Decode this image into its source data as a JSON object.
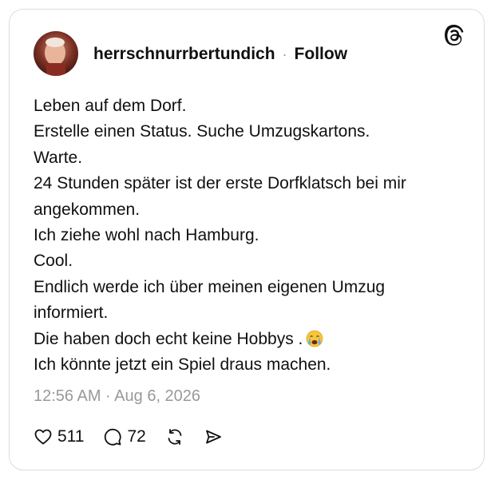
{
  "post": {
    "username": "herrschnurrbertundich",
    "separator": "·",
    "follow_label": "Follow",
    "lines": [
      "Leben auf dem Dorf.",
      "Erstelle einen Status. Suche Umzugskartons.",
      "Warte.",
      "24 Stunden später ist der erste Dorfklatsch bei mir",
      "angekommen.",
      "Ich ziehe wohl nach Hamburg.",
      "Cool.",
      "Endlich werde ich über meinen eigenen Umzug",
      "informiert.",
      "Die haben doch echt keine Hobbys .",
      "Ich könnte jetzt ein Spiel draus machen."
    ],
    "emoji": "crying-face-emoji",
    "timestamp": "12:56 AM · Aug 6, 2026"
  },
  "actions": {
    "likes": "511",
    "replies": "72"
  },
  "colors": {
    "text": "#101010",
    "muted": "#999999",
    "border": "#dcdcdc"
  }
}
